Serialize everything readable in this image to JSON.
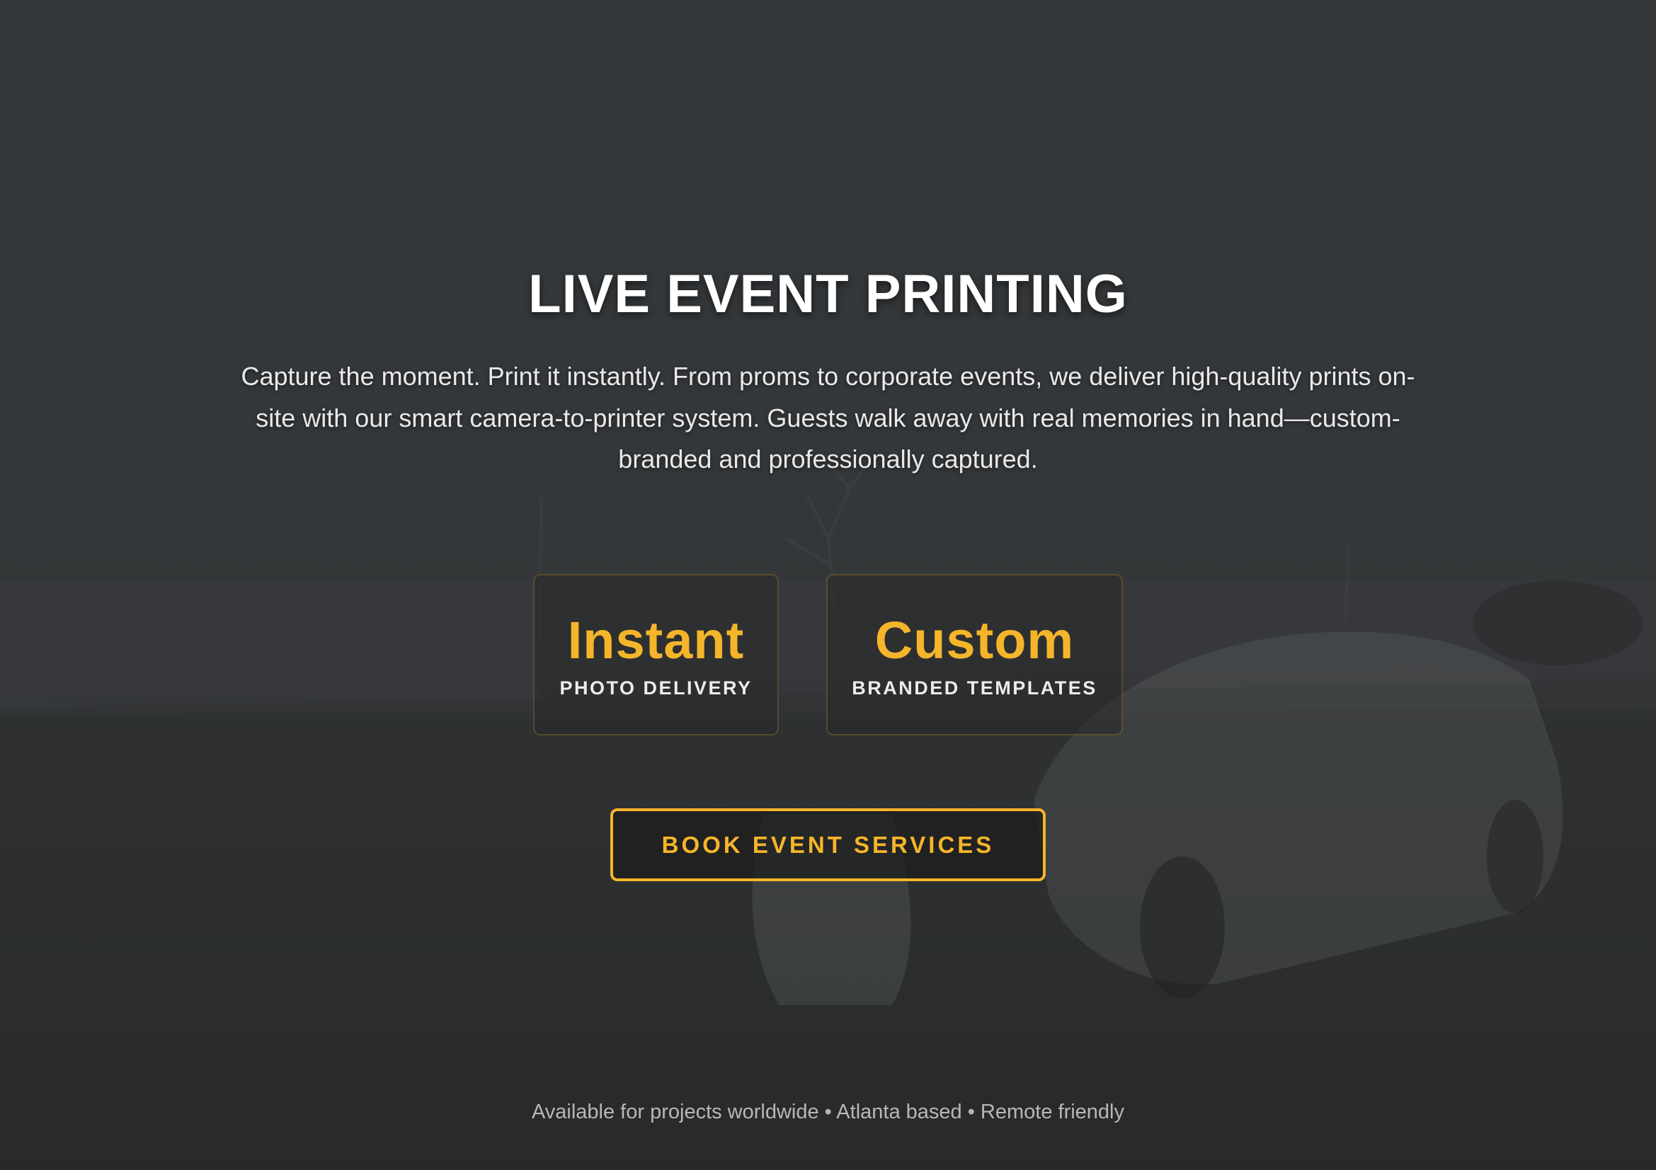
{
  "hero": {
    "title": "LIVE EVENT PRINTING",
    "description": "Capture the moment. Print it instantly. From proms to corporate events, we deliver high-quality prints on-site with our smart camera-to-printer system. Guests walk away with real memories in hand—custom-branded and professionally captured.",
    "stats": [
      {
        "value": "Instant",
        "label": "PHOTO DELIVERY"
      },
      {
        "value": "Custom",
        "label": "BRANDED TEMPLATES"
      }
    ],
    "cta_label": "BOOK EVENT SERVICES",
    "footer_note": "Available for projects worldwide • Atlanta based • Remote friendly"
  },
  "colors": {
    "accent": "#f5b52a",
    "background": "#3a3e41",
    "text": "#ffffff"
  }
}
